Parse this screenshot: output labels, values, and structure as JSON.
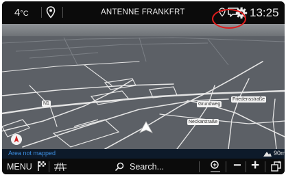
{
  "top_bar": {
    "temperature": "4",
    "temperature_unit": "°C",
    "radio_station": "ANTENNE FRANKFRT",
    "time": "13:25"
  },
  "map": {
    "street_labels": [
      "N1",
      "Friedensstraße",
      "Grundweg",
      "Neckarstraße"
    ]
  },
  "status_bar": {
    "message": "Area not mapped",
    "scale": "90m"
  },
  "bottom_bar": {
    "menu_label": "MENU",
    "search_label": "Search...",
    "zoom_out_label": "−",
    "zoom_in_label": "+"
  },
  "colors": {
    "status_text": "#3d8ee0",
    "highlight_circle": "#e01c1c",
    "map_background": "#5c6066",
    "road": "#e4e4e4"
  },
  "icons": [
    "location-pin-icon",
    "message-icon",
    "settings-gear-icon",
    "compass-icon",
    "vehicle-position-icon",
    "scale-icon",
    "flag-icon",
    "grid-icon",
    "search-icon",
    "zoom-auto-icon",
    "layers-icon"
  ]
}
